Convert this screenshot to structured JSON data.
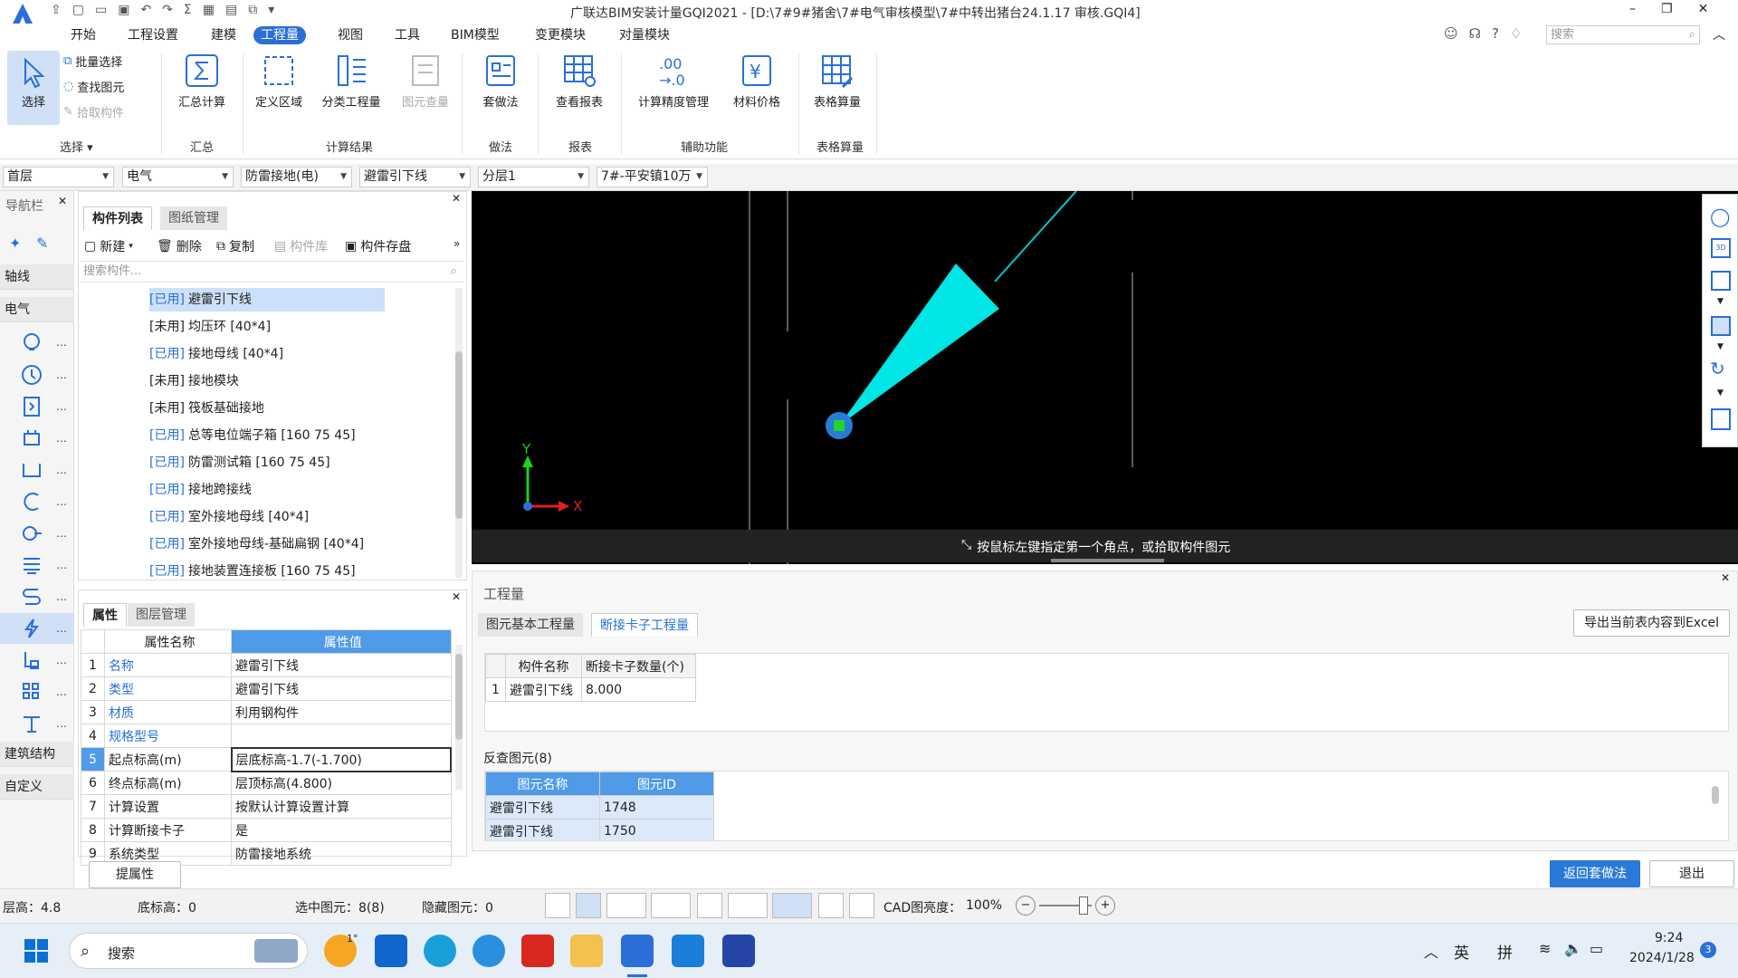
{
  "title": "广联达BIM安装计量GQI2021 - [D:\\7#9#猪舍\\7#电气审核模型\\7#中转出猪台24.1.17 审核.GQI4]",
  "search_placeholder": "搜索",
  "menus": [
    "开始",
    "工程设置",
    "建模",
    "工程量",
    "视图",
    "工具",
    "BIM模型",
    "变更模块",
    "对量模块"
  ],
  "ribbon": {
    "select": "选择",
    "batch_select": "批量选择",
    "find_elem": "查找图元",
    "pick_comp": "拾取构件",
    "sum_calc": "汇总计算",
    "def_region": "定义区域",
    "class_qty": "分类工程量",
    "elem_check": "图元查量",
    "method": "套做法",
    "view_report": "查看报表",
    "precision": "计算精度管理",
    "material_price": "材料价格",
    "table_calc": "表格算量",
    "groups": [
      "选择",
      "汇总",
      "计算结果",
      "做法",
      "报表",
      "辅助功能",
      "表格算量"
    ]
  },
  "dropdowns": [
    "首层",
    "电气",
    "防雷接地(电)",
    "避雷引下线",
    "分层1",
    "7#-平安镇10万"
  ],
  "nav": {
    "title": "导航栏",
    "axis": "轴线",
    "electric": "电气",
    "building": "建筑结构",
    "custom": "自定义"
  },
  "comp": {
    "tab_list": "构件列表",
    "tab_drawing": "图纸管理",
    "new": "新建",
    "delete": "删除",
    "copy": "复制",
    "library": "构件库",
    "save": "构件存盘",
    "search_placeholder": "搜索构件...",
    "items": [
      {
        "tag": "[已用]",
        "name": "避雷引下线"
      },
      {
        "tag": "[未用]",
        "name": "均压环 [40*4]"
      },
      {
        "tag": "[已用]",
        "name": "接地母线 [40*4]"
      },
      {
        "tag": "[未用]",
        "name": "接地模块"
      },
      {
        "tag": "[未用]",
        "name": "筏板基础接地"
      },
      {
        "tag": "[已用]",
        "name": "总等电位端子箱 [160 75 45]"
      },
      {
        "tag": "[已用]",
        "name": "防雷测试箱 [160 75 45]"
      },
      {
        "tag": "[已用]",
        "name": "接地跨接线"
      },
      {
        "tag": "[已用]",
        "name": "室外接地母线 [40*4]"
      },
      {
        "tag": "[已用]",
        "name": "室外接地母线-基础扁钢 [40*4]"
      },
      {
        "tag": "[已用]",
        "name": "接地装置连接板 [160 75 45]"
      }
    ]
  },
  "props": {
    "tab_attr": "属性",
    "tab_layer": "图层管理",
    "col_name": "属性名称",
    "col_value": "属性值",
    "extract_btn": "提属性",
    "rows": [
      {
        "n": "1",
        "k": "名称",
        "v": "避雷引下线"
      },
      {
        "n": "2",
        "k": "类型",
        "v": "避雷引下线"
      },
      {
        "n": "3",
        "k": "材质",
        "v": "利用钢构件"
      },
      {
        "n": "4",
        "k": "规格型号",
        "v": ""
      },
      {
        "n": "5",
        "k": "起点标高(m)",
        "v": "层底标高-1.7(-1.700)"
      },
      {
        "n": "6",
        "k": "终点标高(m)",
        "v": "层顶标高(4.800)"
      },
      {
        "n": "7",
        "k": "计算设置",
        "v": "按默认计算设置计算"
      },
      {
        "n": "8",
        "k": "计算断接卡子",
        "v": "是"
      },
      {
        "n": "9",
        "k": "系统类型",
        "v": "防雷接地系统"
      }
    ]
  },
  "canvas": {
    "hint": "按鼠标左键指定第一个角点，或拾取构件图元",
    "axis_x": "X",
    "axis_y": "Y"
  },
  "qty": {
    "title": "工程量",
    "tab_basic": "图元基本工程量",
    "tab_card": "断接卡子工程量",
    "export": "导出当前表内容到Excel",
    "col1": "构件名称",
    "col2": "断接卡子数量(个)",
    "row_n": "1",
    "row_name": "避雷引下线",
    "row_val": "8.000",
    "reverse_title": "反查图元(8)",
    "rcol1": "图元名称",
    "rcol2": "图元ID",
    "rrows": [
      {
        "name": "避雷引下线",
        "id": "1748"
      },
      {
        "name": "避雷引下线",
        "id": "1750"
      }
    ],
    "btn_return": "返回套做法",
    "btn_exit": "退出"
  },
  "status": {
    "floor_h": "层高：4.8",
    "bottom_h": "底标高：0",
    "selected": "选中图元：8(8)",
    "hidden": "隐藏图元：0",
    "cad_bright": "CAD图亮度：",
    "brightness": "100%"
  },
  "taskbar": {
    "search": "搜索",
    "lang": "英",
    "ime": "拼",
    "time": "9:24",
    "date": "2024/1/28",
    "badge": "3",
    "temp": "1°"
  }
}
